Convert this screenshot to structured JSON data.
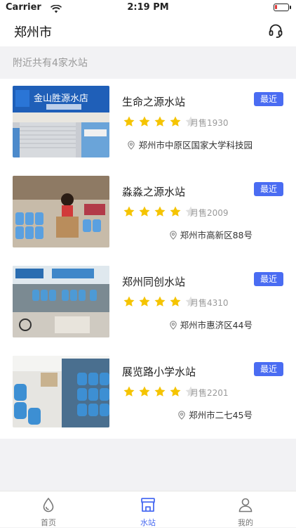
{
  "status_bar": {
    "carrier": "Carrier",
    "time": "2:19 PM",
    "battery_level": 0.15
  },
  "header": {
    "city": "郑州市",
    "service_icon": "headset-icon"
  },
  "summary": {
    "text": "附近共有4家水站"
  },
  "stations": [
    {
      "name": "生命之源水站",
      "badge": "最近",
      "rating": 4,
      "sold": "月售1930",
      "address": "郑州市中原区国家大学科技园",
      "thumb": "storefront-photo"
    },
    {
      "name": "淼淼之源水站",
      "badge": "最近",
      "rating": 4,
      "sold": "月售2009",
      "address": "郑州市高新区88号",
      "thumb": "storefront-photo"
    },
    {
      "name": "郑州同创水站",
      "badge": "最近",
      "rating": 4,
      "sold": "月售4310",
      "address": "郑州市惠济区44号",
      "thumb": "storefront-photo"
    },
    {
      "name": "展览路小学水站",
      "badge": "最近",
      "rating": 4,
      "sold": "月售2201",
      "address": "郑州市二七45号",
      "thumb": "storefront-photo"
    }
  ],
  "tabbar": {
    "tabs": [
      {
        "label": "首页",
        "icon": "water-drop-icon",
        "active": false
      },
      {
        "label": "水站",
        "icon": "store-icon",
        "active": true
      },
      {
        "label": "我的",
        "icon": "user-icon",
        "active": false
      }
    ]
  },
  "colors": {
    "accent": "#4a6cf2",
    "star": "#f5c400",
    "star_empty": "#e0e0e0"
  }
}
